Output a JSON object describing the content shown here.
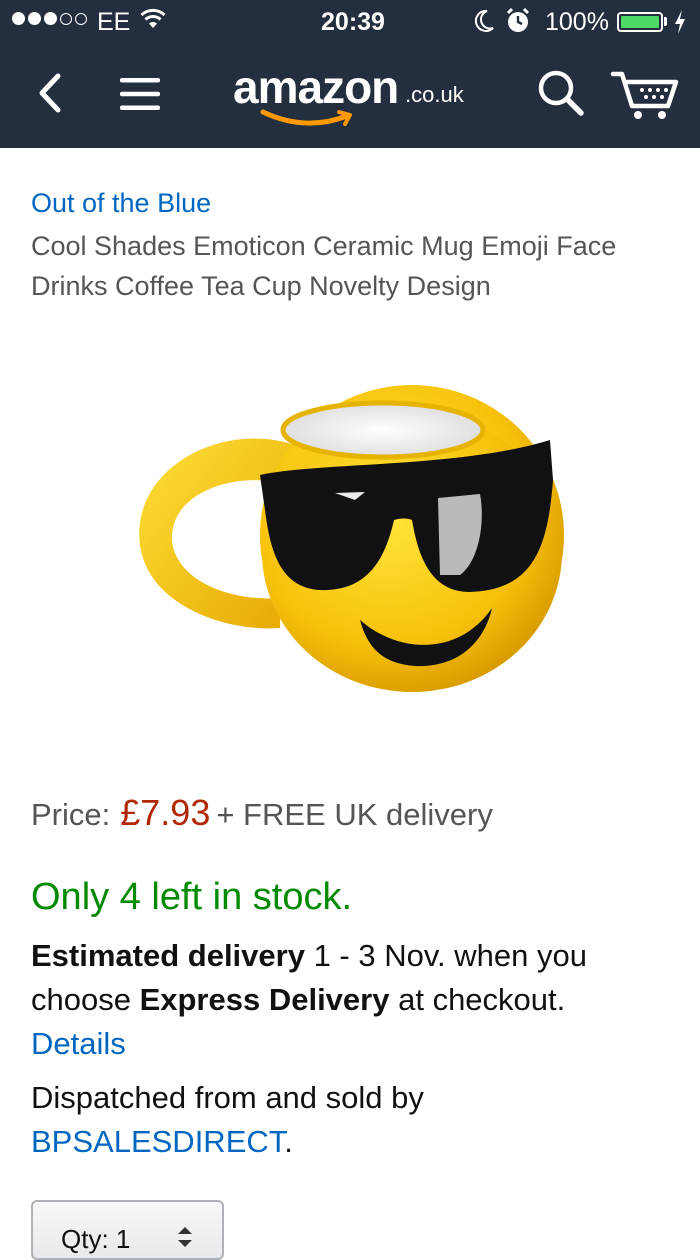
{
  "status_bar": {
    "carrier": "EE",
    "time": "20:39",
    "battery_percent": "100%",
    "signal_bars_filled": 3,
    "signal_bars_total": 5
  },
  "nav": {
    "logo_word": "amazon",
    "logo_tld": ".co.uk",
    "icons": [
      "back-icon",
      "menu-icon",
      "search-icon",
      "cart-icon"
    ]
  },
  "product": {
    "brand": "Out of the Blue",
    "title": "Cool Shades Emoticon Ceramic Mug Emoji Face Drinks Coffee Tea Cup Novelty Design",
    "image_alt": "yellow emoji mug with sunglasses"
  },
  "pricing": {
    "label": "Price:",
    "price": "£7.93",
    "delivery_note": "+ FREE UK delivery"
  },
  "stock": {
    "text": "Only 4 left in stock."
  },
  "delivery": {
    "estimated_label": "Estimated delivery",
    "dates": " 1 - 3 Nov. when you choose ",
    "method": "Express Delivery",
    "suffix": " at checkout.",
    "details_link": "Details"
  },
  "seller": {
    "prefix": "Dispatched from and sold by",
    "name": "BPSALESDIRECT",
    "suffix": "."
  },
  "quantity": {
    "label": "Qty: 1"
  },
  "colors": {
    "nav_bg": "#232f3e",
    "link": "#0066c0",
    "price": "#b12704",
    "in_stock": "#008a00",
    "smile_orange": "#ff9900"
  }
}
